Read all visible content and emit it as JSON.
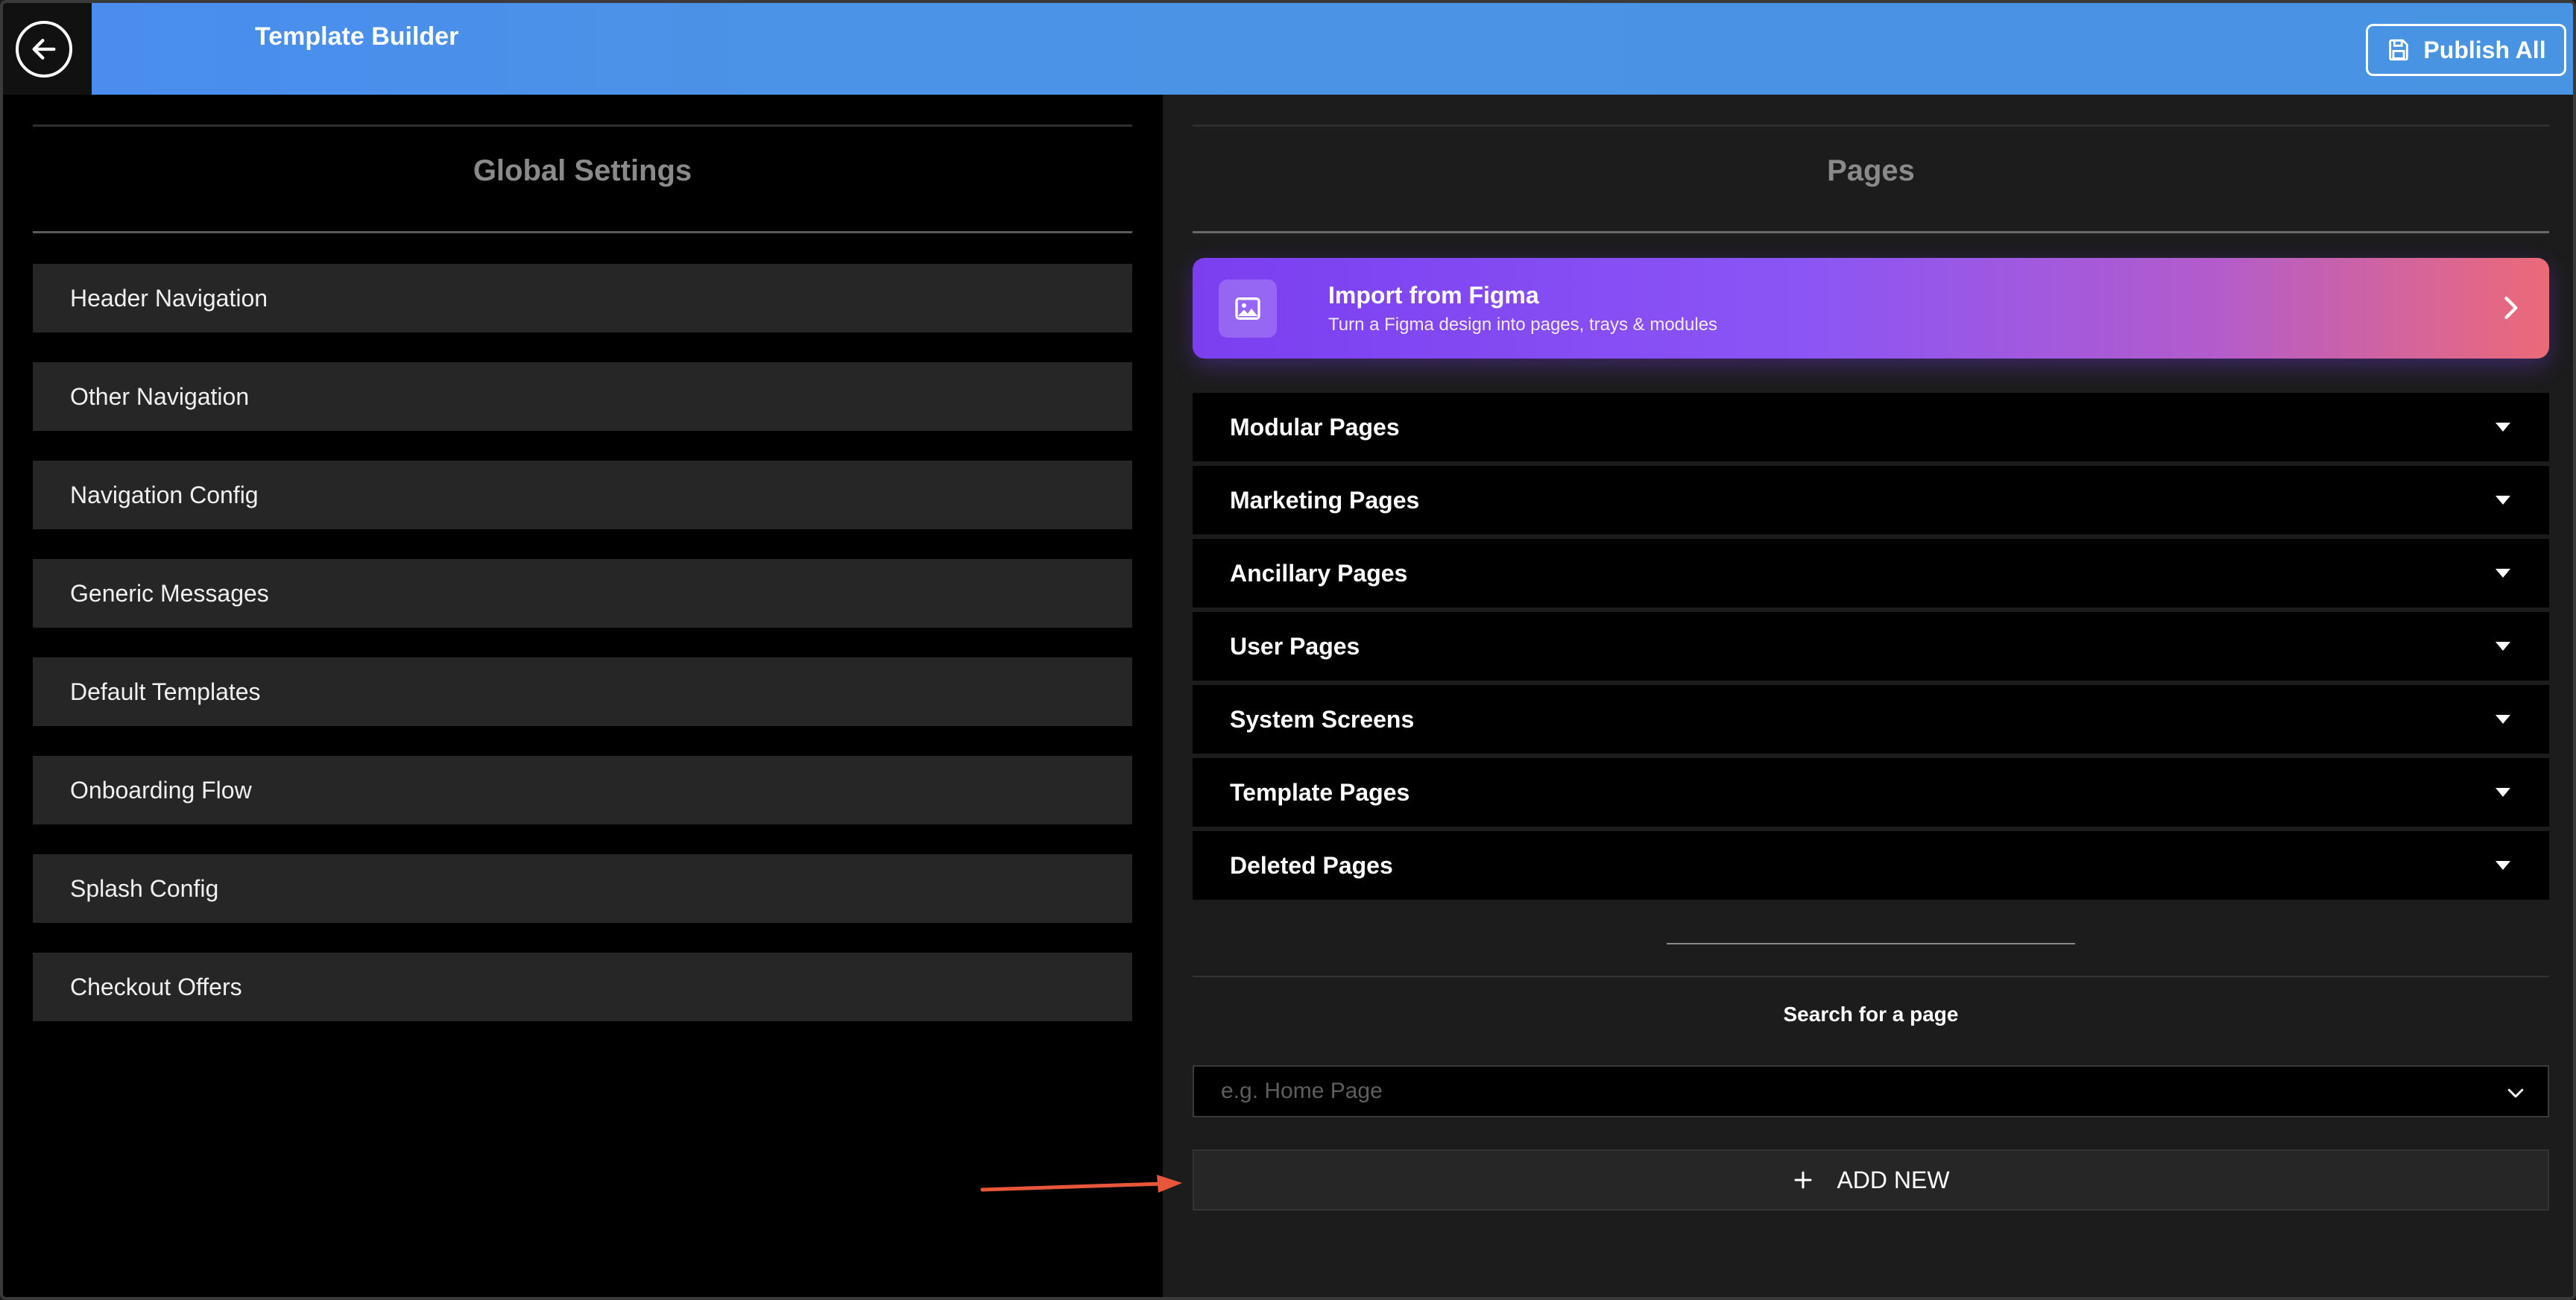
{
  "header": {
    "title": "Template Builder",
    "publish_label": "Publish All",
    "back_icon": "arrow-left-icon",
    "publish_icon": "floppy-disk-icon",
    "colors": {
      "bar": "#4a90e6",
      "back_bg": "#111111"
    }
  },
  "global_settings": {
    "title": "Global Settings",
    "items": [
      {
        "label": "Header Navigation"
      },
      {
        "label": "Other Navigation"
      },
      {
        "label": "Navigation Config"
      },
      {
        "label": "Generic Messages"
      },
      {
        "label": "Default Templates"
      },
      {
        "label": "Onboarding Flow"
      },
      {
        "label": "Splash Config"
      },
      {
        "label": "Checkout Offers"
      }
    ]
  },
  "pages": {
    "title": "Pages",
    "figma": {
      "title": "Import from Figma",
      "subtitle": "Turn a Figma design into pages, trays & modules",
      "icon": "image-icon"
    },
    "sections": [
      {
        "label": "Modular Pages"
      },
      {
        "label": "Marketing Pages"
      },
      {
        "label": "Ancillary Pages"
      },
      {
        "label": "User Pages"
      },
      {
        "label": "System Screens"
      },
      {
        "label": "Template Pages"
      },
      {
        "label": "Deleted Pages"
      }
    ],
    "search": {
      "label": "Search for a page",
      "placeholder": "e.g. Home Page",
      "value": ""
    },
    "add_new_label": "ADD NEW"
  },
  "annotation": {
    "color": "#e8573a"
  }
}
